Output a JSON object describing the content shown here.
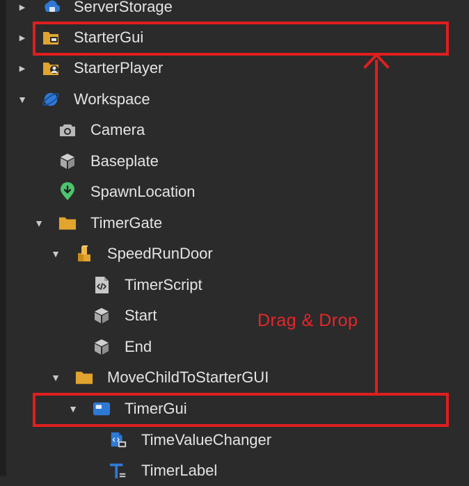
{
  "explorer": {
    "items": [
      {
        "label": "ServerStorage",
        "icon": "server-storage-icon",
        "expanded": false
      },
      {
        "label": "StarterGui",
        "icon": "starter-gui-folder-icon",
        "expanded": false
      },
      {
        "label": "StarterPlayer",
        "icon": "starter-player-folder-icon",
        "expanded": false
      },
      {
        "label": "Workspace",
        "icon": "workspace-globe-icon",
        "expanded": true
      },
      {
        "label": "Camera",
        "icon": "camera-icon"
      },
      {
        "label": "Baseplate",
        "icon": "part-cube-icon"
      },
      {
        "label": "SpawnLocation",
        "icon": "spawn-location-icon"
      },
      {
        "label": "TimerGate",
        "icon": "folder-icon",
        "expanded": true
      },
      {
        "label": "SpeedRunDoor",
        "icon": "model-icon",
        "expanded": true
      },
      {
        "label": "TimerScript",
        "icon": "script-icon"
      },
      {
        "label": "Start",
        "icon": "part-cube-icon"
      },
      {
        "label": "End",
        "icon": "part-cube-icon"
      },
      {
        "label": "MoveChildToStarterGUI",
        "icon": "folder-icon",
        "expanded": true
      },
      {
        "label": "TimerGui",
        "icon": "screen-gui-icon",
        "expanded": true
      },
      {
        "label": "TimeValueChanger",
        "icon": "local-script-icon"
      },
      {
        "label": "TimerLabel",
        "icon": "text-label-icon"
      }
    ]
  },
  "annotation": {
    "text": "Drag & Drop",
    "color": "#e01e1e"
  },
  "colors": {
    "background": "#2b2b2b",
    "text": "#e4e4e4",
    "folder": "#e2a42f",
    "accent_blue": "#2f79d6",
    "spawn_green": "#4cc46e",
    "part_gray": "#b8b8b8"
  }
}
